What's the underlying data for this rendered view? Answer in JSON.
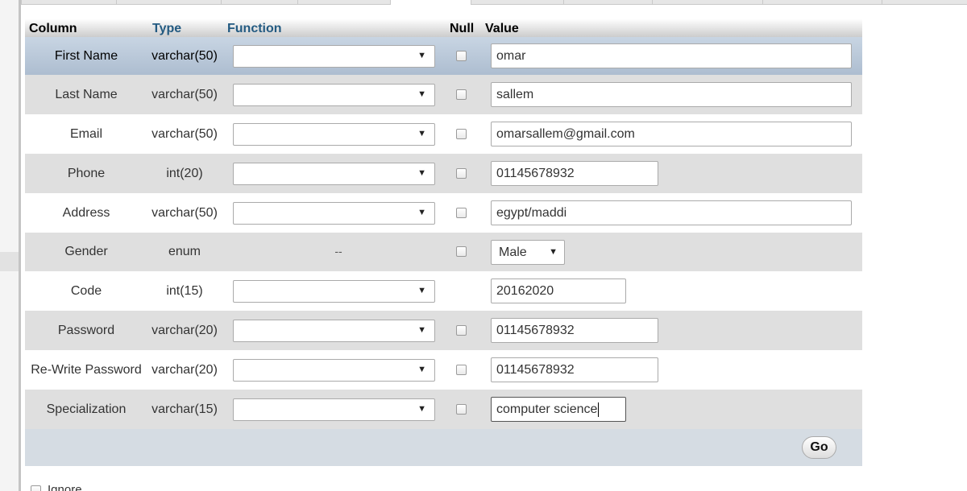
{
  "headers": {
    "column": "Column",
    "type": "Type",
    "function": "Function",
    "null": "Null",
    "value": "Value"
  },
  "rows": [
    {
      "column": "First Name",
      "type": "varchar(50)",
      "has_function": true,
      "has_null": true,
      "value": "omar"
    },
    {
      "column": "Last Name",
      "type": "varchar(50)",
      "has_function": true,
      "has_null": true,
      "value": "sallem"
    },
    {
      "column": "Email",
      "type": "varchar(50)",
      "has_function": true,
      "has_null": true,
      "value": "omarsallem@gmail.com"
    },
    {
      "column": "Phone",
      "type": "int(20)",
      "has_function": true,
      "has_null": true,
      "value": "01145678932"
    },
    {
      "column": "Address",
      "type": "varchar(50)",
      "has_function": true,
      "has_null": true,
      "value": "egypt/maddi"
    },
    {
      "column": "Gender",
      "type": "enum",
      "function_text": "--",
      "has_null": true,
      "value": "Male"
    },
    {
      "column": "Code",
      "type": "int(15)",
      "has_function": true,
      "has_null": false,
      "value": "20162020"
    },
    {
      "column": "Password",
      "type": "varchar(20)",
      "has_function": true,
      "has_null": true,
      "value": "01145678932"
    },
    {
      "column": "Re-Write Password",
      "type": "varchar(20)",
      "has_function": true,
      "has_null": true,
      "value": "01145678932"
    },
    {
      "column": "Specialization",
      "type": "varchar(15)",
      "has_function": true,
      "has_null": true,
      "value": "computer science"
    }
  ],
  "go_label": "Go",
  "ignore_label": "Ignore",
  "icons": {
    "dropdown": "chevron-down-icon",
    "null_checkbox": "checkbox-icon"
  },
  "colors": {
    "header_blue": "#235a81",
    "row_highlight": "#c8d5e3",
    "row_even": "#dfdfdf",
    "footer": "#d5dce3"
  }
}
